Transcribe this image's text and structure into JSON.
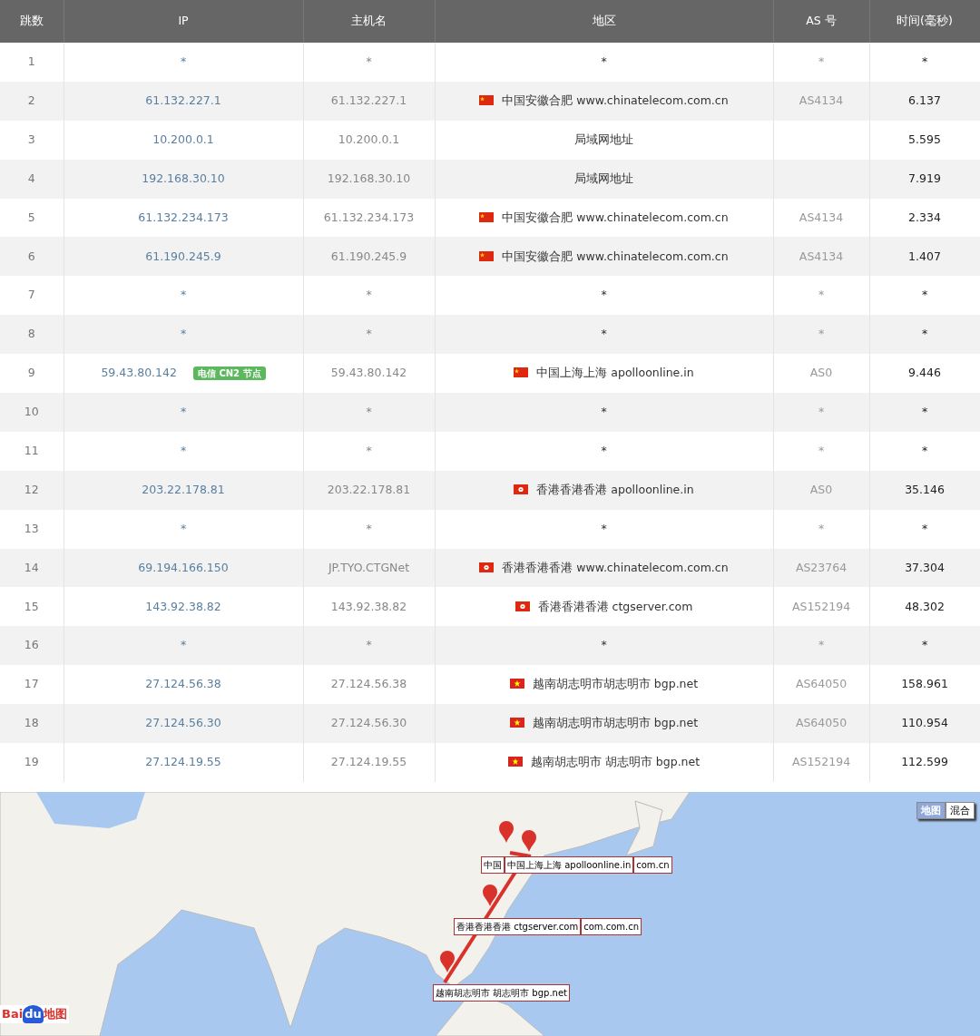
{
  "table": {
    "columns": [
      "跳数",
      "IP",
      "主机名",
      "地区",
      "AS 号",
      "时间(毫秒)"
    ],
    "rows": [
      {
        "hop": "1",
        "ip": "*",
        "hostname": "*",
        "region": "*",
        "as": "*",
        "time": "*"
      },
      {
        "hop": "2",
        "ip": "61.132.227.1",
        "hostname": "61.132.227.1",
        "kind": "cn",
        "region": "中国安徽合肥 www.chinatelecom.com.cn",
        "as": "AS4134",
        "time": "6.137"
      },
      {
        "hop": "3",
        "ip": "10.200.0.1",
        "hostname": "10.200.0.1",
        "region": "局域网地址",
        "time": "5.595"
      },
      {
        "hop": "4",
        "ip": "192.168.30.10",
        "hostname": "192.168.30.10",
        "region": "局域网地址",
        "time": "7.919"
      },
      {
        "hop": "5",
        "ip": "61.132.234.173",
        "hostname": "61.132.234.173",
        "kind": "cn",
        "region": "中国安徽合肥 www.chinatelecom.com.cn",
        "as": "AS4134",
        "time": "2.334"
      },
      {
        "hop": "6",
        "ip": "61.190.245.9",
        "hostname": "61.190.245.9",
        "kind": "cn",
        "region": "中国安徽合肥 www.chinatelecom.com.cn",
        "as": "AS4134",
        "time": "1.407"
      },
      {
        "hop": "7",
        "ip": "*",
        "hostname": "*",
        "region": "*",
        "as": "*",
        "time": "*"
      },
      {
        "hop": "8",
        "ip": "*",
        "hostname": "*",
        "region": "*",
        "as": "*",
        "time": "*"
      },
      {
        "hop": "9",
        "ip": "59.43.80.142",
        "badge": "电信 CN2 节点",
        "hostname": "59.43.80.142",
        "kind": "cn",
        "region": "中国上海上海 apolloonline.in",
        "as": "AS0",
        "time": "9.446"
      },
      {
        "hop": "10",
        "ip": "*",
        "hostname": "*",
        "region": "*",
        "as": "*",
        "time": "*"
      },
      {
        "hop": "11",
        "ip": "*",
        "hostname": "*",
        "region": "*",
        "as": "*",
        "time": "*"
      },
      {
        "hop": "12",
        "ip": "203.22.178.81",
        "hostname": "203.22.178.81",
        "kind": "hk",
        "region": "香港香港香港 apolloonline.in",
        "as": "AS0",
        "time": "35.146"
      },
      {
        "hop": "13",
        "ip": "*",
        "hostname": "*",
        "region": "*",
        "as": "*",
        "time": "*"
      },
      {
        "hop": "14",
        "ip": "69.194.166.150",
        "hostname": "JP.TYO.CTGNet",
        "kind": "hk",
        "region": "香港香港香港 www.chinatelecom.com.cn",
        "as": "AS23764",
        "time": "37.304"
      },
      {
        "hop": "15",
        "ip": "143.92.38.82",
        "hostname": "143.92.38.82",
        "kind": "hk",
        "region": "香港香港香港 ctgserver.com",
        "as": "AS152194",
        "time": "48.302"
      },
      {
        "hop": "16",
        "ip": "*",
        "hostname": "*",
        "region": "*",
        "as": "*",
        "time": "*"
      },
      {
        "hop": "17",
        "ip": "27.124.56.38",
        "hostname": "27.124.56.38",
        "kind": "vn",
        "region": "越南胡志明市胡志明市 bgp.net",
        "as": "AS64050",
        "time": "158.961"
      },
      {
        "hop": "18",
        "ip": "27.124.56.30",
        "hostname": "27.124.56.30",
        "kind": "vn",
        "region": "越南胡志明市胡志明市 bgp.net",
        "as": "AS64050",
        "time": "110.954"
      },
      {
        "hop": "19",
        "ip": "27.124.19.55",
        "hostname": "27.124.19.55",
        "kind": "vn",
        "region": "越南胡志明市 胡志明市 bgp.net",
        "as": "AS152194",
        "time": "112.599"
      }
    ]
  },
  "map": {
    "type_buttons": [
      {
        "label": "地图",
        "selected": true
      },
      {
        "label": "混合",
        "selected": false
      }
    ],
    "logo": [
      "Bai",
      "du",
      "地图"
    ],
    "labels": [
      "中国",
      "中国上海上海 apolloonline.in",
      "com.cn",
      "香港香港香港 ctgserver.com",
      "com.com.cn",
      "越南胡志明市 胡志明市 bgp.net"
    ]
  }
}
